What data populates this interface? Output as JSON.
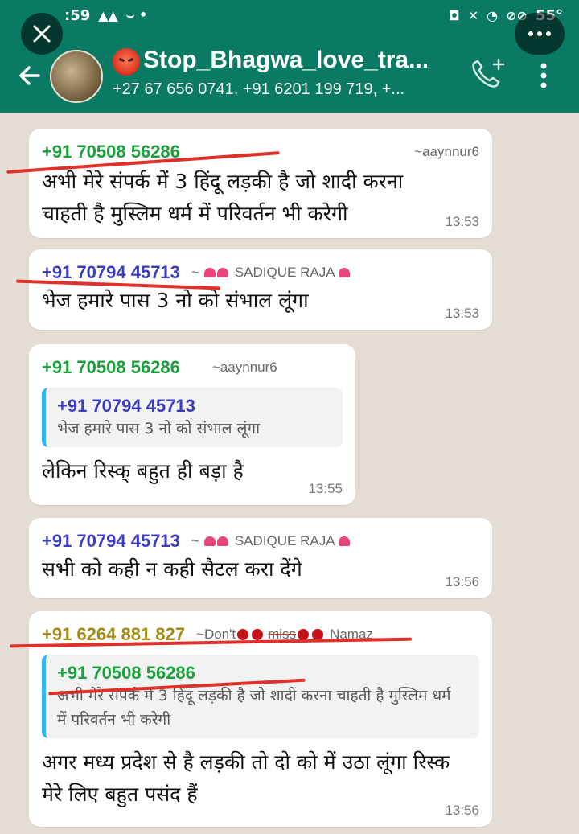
{
  "status_bar": {
    "time": ":59",
    "battery": "55°"
  },
  "header": {
    "group_name": "Stop_Bhagwa_love_tra...",
    "participants": "+27 67 656 0741, +91 6201 199 719, +..."
  },
  "messages": [
    {
      "number": "+91 70508 56286",
      "name": "~aaynnur6",
      "number_color": "#1a9f3b",
      "text": "अभी मेरे संपर्क में 3 हिंदू लड़की है जो शादी करना चाहती है मुस्लिम धर्म में परिवर्तन भी करेगी",
      "time": "13:53"
    },
    {
      "number": "+91 70794 45713",
      "name": "SADIQUE RAJA",
      "name_prefix": "~",
      "number_color": "#3b3bbf",
      "text": "भेज हमारे पास 3 नो को संभाल लूंगा",
      "time": "13:53"
    },
    {
      "number": "+91 70508 56286",
      "name": "~aaynnur6",
      "number_color": "#1a9f3b",
      "quote": {
        "number": "+91 70794 45713",
        "text": "भेज हमारे पास 3 नो को संभाल लूंगा"
      },
      "text": "लेकिन रिस्क् बहुत ही बड़ा है",
      "time": "13:55"
    },
    {
      "number": "+91 70794 45713",
      "name": "SADIQUE RAJA",
      "name_prefix": "~",
      "number_color": "#3b3bbf",
      "text": "सभी को कही न कही सैटल करा देंगे",
      "time": "13:56"
    },
    {
      "number": "+91 6264 881 827",
      "name_prefix": "~Don't",
      "name_mid": "miss",
      "name": "Namaz",
      "number_color": "#a38a12",
      "quote": {
        "number": "+91 70508 56286",
        "text": "अभी मेरे संपर्क में 3 हिंदू लड़की है जो शादी करना चाहती है मुस्लिम धर्म में परिवर्तन भी करेगी"
      },
      "text": "अगर मध्य प्रदेश से है लड़की तो दो को में उठा लूंगा रिस्क मेरे लिए बहुत पसंद हैं",
      "time": "13:56"
    }
  ],
  "colors": {
    "header_bg": "#0b7a64",
    "chat_bg": "#e3ddd5",
    "underline": "#e0302a",
    "quote_bar": "#34b7f1"
  },
  "icons": [
    "close-icon",
    "more-icon",
    "back-arrow-icon",
    "add-call-icon",
    "kebab-menu-icon",
    "wifi-icon",
    "battery-icon"
  ]
}
